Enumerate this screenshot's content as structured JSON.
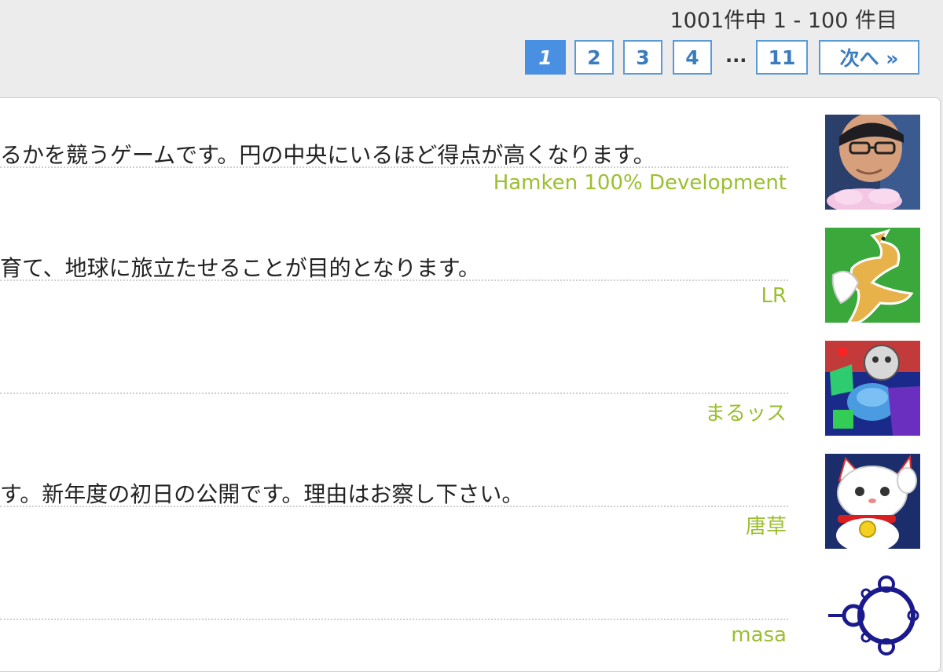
{
  "results": {
    "summary": "1001件中 1 - 100 件目"
  },
  "pagination": {
    "current": "1",
    "pages": [
      "2",
      "3",
      "4"
    ],
    "ellipsis": "...",
    "last": "11",
    "next": "次へ »"
  },
  "items": [
    {
      "description": "るかを競うゲームです。円の中央にいるほど得点が高くなります。",
      "author": "Hamken 100% Development",
      "avatar_icon": "person-photo-icon"
    },
    {
      "description": "育て、地球に旅立たせることが目的となります。",
      "author": "LR",
      "avatar_icon": "fox-icon"
    },
    {
      "description": "",
      "author": "まるッス",
      "avatar_icon": "pixel-monsters-icon"
    },
    {
      "description": "す。新年度の初日の公開です。理由はお察し下さい。",
      "author": "唐草",
      "avatar_icon": "lucky-cat-icon"
    },
    {
      "description": "",
      "author": "masa",
      "avatar_icon": "mandelbrot-icon"
    }
  ],
  "colors": {
    "accent": "#4a90e2",
    "author_text": "#9bbf2f",
    "page_border": "#5b9bd5"
  }
}
